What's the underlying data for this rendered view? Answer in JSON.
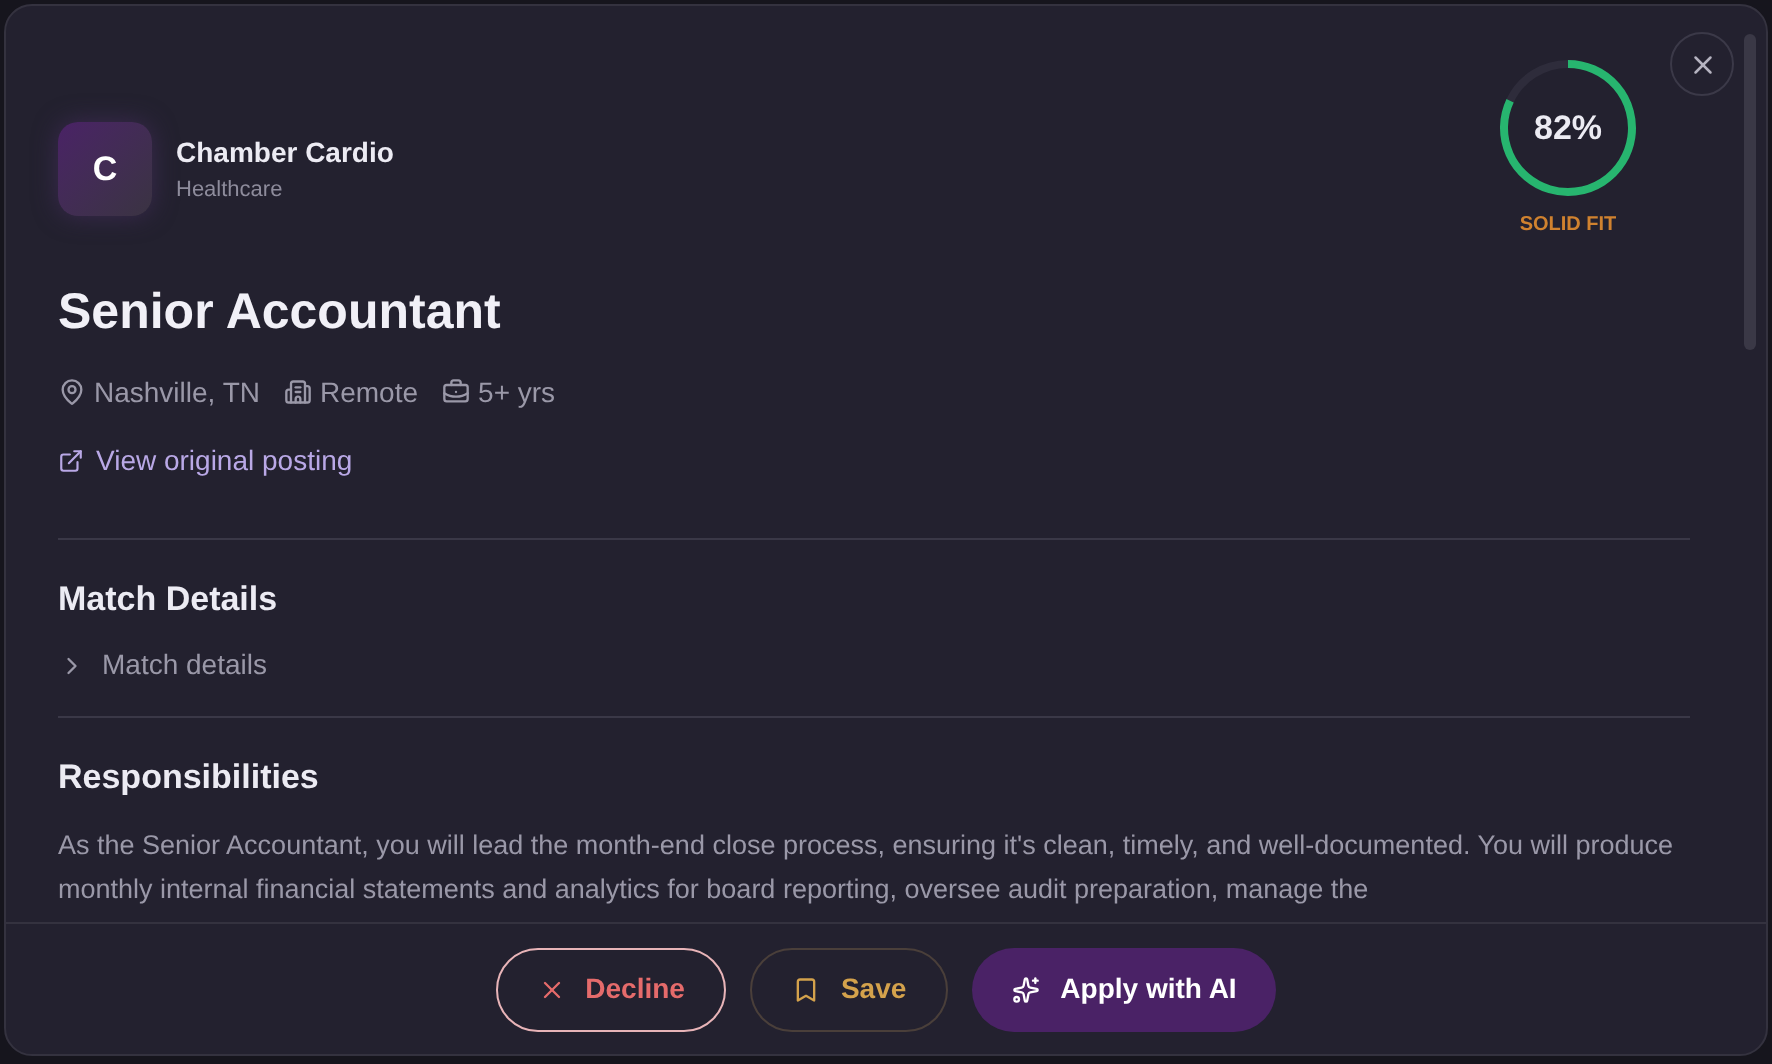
{
  "company": {
    "initial": "C",
    "name": "Chamber Cardio",
    "industry": "Healthcare"
  },
  "score": {
    "value": "82%",
    "level": 0.82,
    "label": "SOLID FIT"
  },
  "job": {
    "title": "Senior Accountant",
    "meta": [
      {
        "kind": "location",
        "text": "Nashville, TN"
      },
      {
        "kind": "workplace",
        "text": "Remote"
      },
      {
        "kind": "experience",
        "text": "5+ yrs"
      }
    ],
    "link": "View original posting"
  },
  "match": {
    "heading": "Match Details",
    "toggle": "Match details",
    "expanded": false
  },
  "responsibilities": {
    "heading": "Responsibilities",
    "text": "As the Senior Accountant, you will lead the month-end close process, ensuring it's clean, timely, and well-documented. You will produce monthly internal financial statements and analytics for board reporting, oversee audit preparation, manage the"
  },
  "actions": [
    {
      "kind": "decline",
      "label": "Decline"
    },
    {
      "kind": "save",
      "label": "Save"
    },
    {
      "kind": "apply",
      "label": "Apply with AI"
    }
  ]
}
